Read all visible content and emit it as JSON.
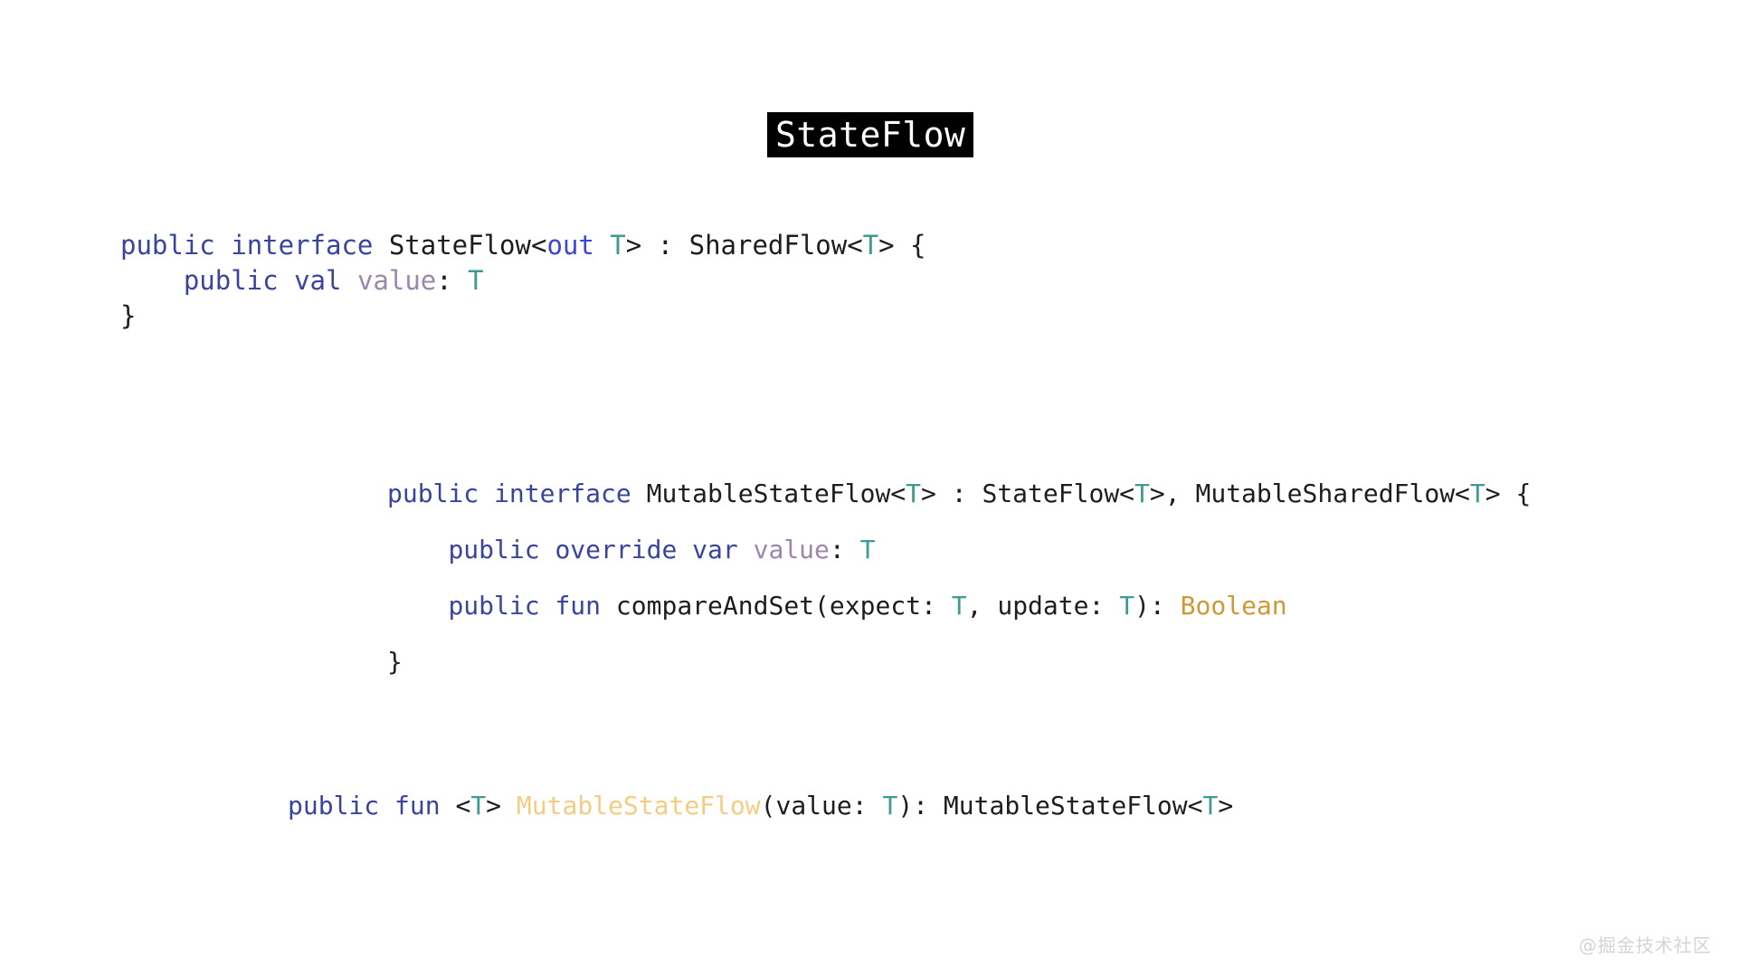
{
  "slide": {
    "background_color": "#ffffff",
    "title": {
      "text": "StateFlow",
      "background_color": "#000000",
      "text_color": "#ffffff"
    },
    "watermark": "@掘金技术社区"
  },
  "palette": {
    "keyword": "#39449c",
    "modifier": "#3b46d8",
    "generic_type": "#3d9a94",
    "property": "#9d86ae",
    "builtin_type": "#cc9933",
    "function_name": "#f2cd82",
    "plain": "#1d1d1d"
  },
  "code_blocks": [
    {
      "id": "stateflow-interface",
      "lines": [
        {
          "id": "line-1",
          "tokens": [
            {
              "t": "public",
              "c": "kw"
            },
            {
              "t": " ",
              "c": "plain"
            },
            {
              "t": "interface",
              "c": "kw"
            },
            {
              "t": " StateFlow<",
              "c": "plain"
            },
            {
              "t": "out",
              "c": "mod"
            },
            {
              "t": " ",
              "c": "plain"
            },
            {
              "t": "T",
              "c": "generic"
            },
            {
              "t": "> : SharedFlow<",
              "c": "plain"
            },
            {
              "t": "T",
              "c": "generic"
            },
            {
              "t": "> {",
              "c": "plain"
            }
          ]
        },
        {
          "id": "line-2",
          "tokens": [
            {
              "t": "    ",
              "c": "plain"
            },
            {
              "t": "public",
              "c": "kw"
            },
            {
              "t": " ",
              "c": "plain"
            },
            {
              "t": "val",
              "c": "kw"
            },
            {
              "t": " ",
              "c": "plain"
            },
            {
              "t": "value",
              "c": "prop"
            },
            {
              "t": ": ",
              "c": "plain"
            },
            {
              "t": "T",
              "c": "generic"
            }
          ]
        },
        {
          "id": "line-3",
          "tokens": [
            {
              "t": "}",
              "c": "plain"
            }
          ]
        }
      ]
    },
    {
      "id": "mutablestateflow-interface",
      "lines": [
        {
          "id": "line-1",
          "tokens": [
            {
              "t": "public",
              "c": "kw"
            },
            {
              "t": " ",
              "c": "plain"
            },
            {
              "t": "interface",
              "c": "kw"
            },
            {
              "t": " MutableStateFlow<",
              "c": "plain"
            },
            {
              "t": "T",
              "c": "generic"
            },
            {
              "t": "> : StateFlow<",
              "c": "plain"
            },
            {
              "t": "T",
              "c": "generic"
            },
            {
              "t": ">, MutableSharedFlow<",
              "c": "plain"
            },
            {
              "t": "T",
              "c": "generic"
            },
            {
              "t": "> {",
              "c": "plain"
            }
          ]
        },
        {
          "id": "line-2",
          "tokens": [
            {
              "t": "    ",
              "c": "plain"
            },
            {
              "t": "public",
              "c": "kw"
            },
            {
              "t": " ",
              "c": "plain"
            },
            {
              "t": "override",
              "c": "kw"
            },
            {
              "t": " ",
              "c": "plain"
            },
            {
              "t": "var",
              "c": "kw"
            },
            {
              "t": " ",
              "c": "plain"
            },
            {
              "t": "value",
              "c": "prop"
            },
            {
              "t": ": ",
              "c": "plain"
            },
            {
              "t": "T",
              "c": "generic"
            }
          ]
        },
        {
          "id": "line-3",
          "tokens": [
            {
              "t": "    ",
              "c": "plain"
            },
            {
              "t": "public",
              "c": "kw"
            },
            {
              "t": " ",
              "c": "plain"
            },
            {
              "t": "fun",
              "c": "kw"
            },
            {
              "t": " compareAndSet(expect: ",
              "c": "plain"
            },
            {
              "t": "T",
              "c": "generic"
            },
            {
              "t": ", update: ",
              "c": "plain"
            },
            {
              "t": "T",
              "c": "generic"
            },
            {
              "t": "): ",
              "c": "plain"
            },
            {
              "t": "Boolean",
              "c": "builtin"
            }
          ]
        },
        {
          "id": "line-4",
          "tokens": [
            {
              "t": "}",
              "c": "plain"
            }
          ]
        }
      ]
    },
    {
      "id": "mutablestateflow-factory",
      "lines": [
        {
          "id": "line-1",
          "tokens": [
            {
              "t": "public",
              "c": "kw"
            },
            {
              "t": " ",
              "c": "plain"
            },
            {
              "t": "fun",
              "c": "kw"
            },
            {
              "t": " <",
              "c": "plain"
            },
            {
              "t": "T",
              "c": "generic"
            },
            {
              "t": "> ",
              "c": "plain"
            },
            {
              "t": "MutableStateFlow",
              "c": "fnname"
            },
            {
              "t": "(value: ",
              "c": "plain"
            },
            {
              "t": "T",
              "c": "generic"
            },
            {
              "t": "): MutableStateFlow<",
              "c": "plain"
            },
            {
              "t": "T",
              "c": "generic"
            },
            {
              "t": ">",
              "c": "plain"
            }
          ]
        }
      ]
    }
  ]
}
